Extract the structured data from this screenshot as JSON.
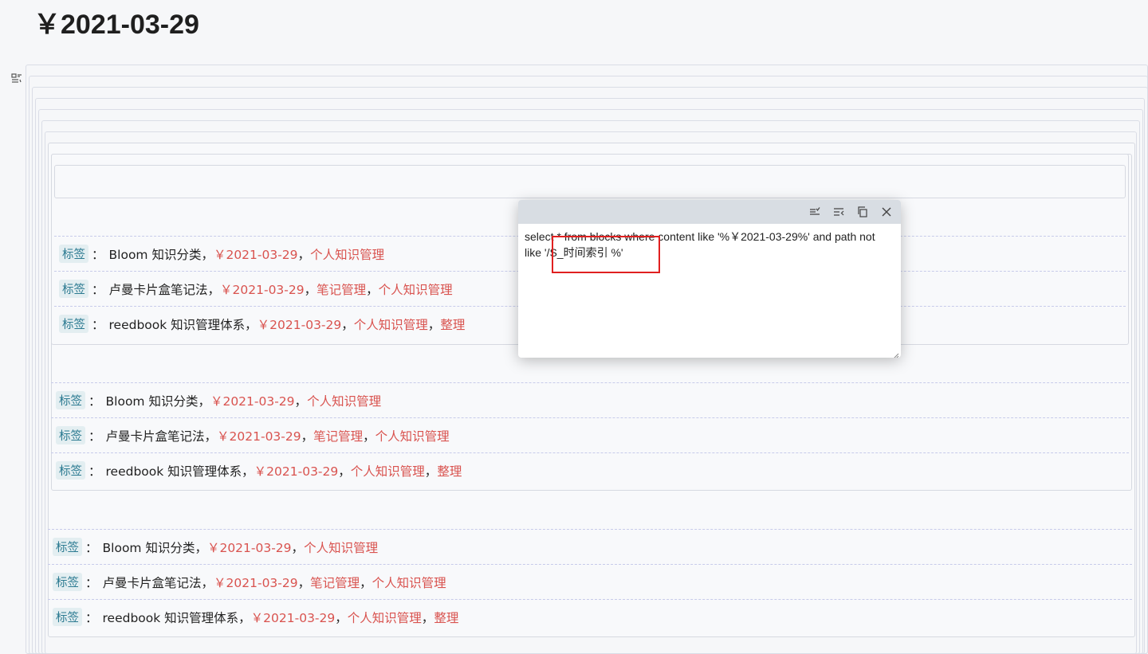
{
  "title": "￥2021-03-29",
  "query": {
    "text": "select * from blocks where content like '%￥2021-03-29%' and path not like '/S_时间索引 %'"
  },
  "toolbar": {
    "icons": [
      "list-check-icon",
      "list-collapse-icon",
      "copy-icon",
      "close-icon"
    ]
  },
  "rows": [
    {
      "label": "标签",
      "colon": "：",
      "title": "Bloom 知识分类，",
      "links": [
        "￥2021-03-29",
        "个人知识管理"
      ]
    },
    {
      "label": "标签",
      "colon": "：",
      "title": "卢曼卡片盒笔记法，",
      "links": [
        "￥2021-03-29",
        "笔记管理",
        "个人知识管理"
      ]
    },
    {
      "label": "标签",
      "colon": "：",
      "title": "reedbook 知识管理体系，",
      "links": [
        "￥2021-03-29",
        "个人知识管理",
        "整理"
      ]
    }
  ],
  "separator": "，"
}
